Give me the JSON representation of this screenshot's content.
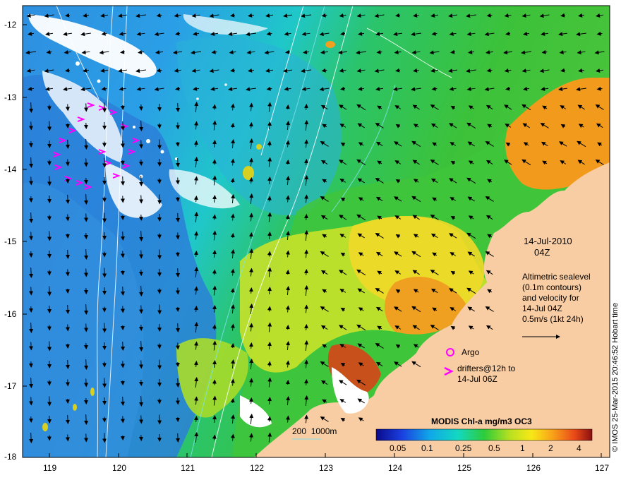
{
  "map": {
    "lat_ticks": [
      "-12",
      "-13",
      "-14",
      "-15",
      "-16",
      "-17",
      "-18"
    ],
    "lon_ticks": [
      "119",
      "120",
      "121",
      "122",
      "123",
      "124",
      "125",
      "126",
      "127"
    ]
  },
  "annotations": {
    "date": "14-Jul-2010",
    "time": "04Z",
    "altimetry_lines": [
      "Altimetric sealevel",
      "(0.1m contours)",
      "and velocity for",
      "14-Jul 04Z",
      "0.5m/s (1kt 24h)"
    ],
    "argo_label": "Argo",
    "drifters_lines": [
      "drifters@12h to",
      "14-Jul 06Z"
    ],
    "isobath_label": "200  1000m"
  },
  "colorbar": {
    "title": "MODIS Chl-a mg/m3 OC3",
    "ticks": [
      "0.05",
      "0.1",
      "0.25",
      "0.5",
      "1",
      "2",
      "4"
    ]
  },
  "credit": "© IMOS 25-Mar-2015 20:46:52 Hobart time",
  "colors": {
    "land": "#f9cda3",
    "cloud": "#ffffff",
    "drifter": "#ff00ff",
    "argo": "#ff00ff"
  }
}
